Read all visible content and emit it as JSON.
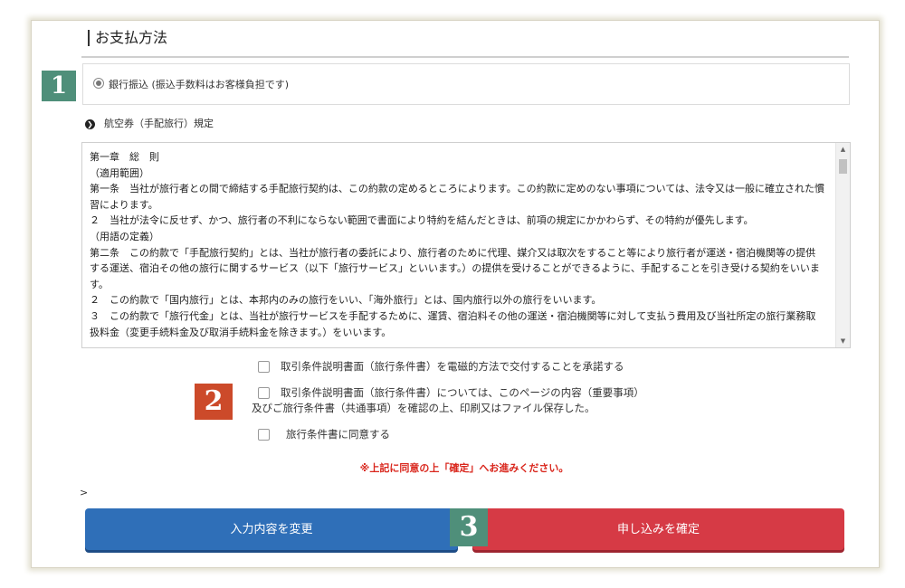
{
  "section": {
    "title": "お支払方法"
  },
  "badges": [
    "1",
    "2",
    "3"
  ],
  "payment": {
    "option_label": "銀行振込 (振込手数料はお客様負担です)",
    "selected": true
  },
  "rules_heading": {
    "icon": "circle-arrow-right-icon",
    "label": "航空券（手配旅行）規定"
  },
  "terms": {
    "lines": [
      "第一章　総　則",
      "（適用範囲）",
      "第一条　当社が旅行者との間で締結する手配旅行契約は、この約款の定めるところによります。この約款に定めのない事項については、法令又は一般に確立された慣習によります。",
      "２　当社が法令に反せず、かつ、旅行者の不利にならない範囲で書面により特約を結んだときは、前項の規定にかかわらず、その特約が優先します。",
      "（用語の定義）",
      "第二条　この約款で「手配旅行契約」とは、当社が旅行者の委託により、旅行者のために代理、媒介又は取次をすること等により旅行者が運送・宿泊機関等の提供する運送、宿泊その他の旅行に関するサービス（以下「旅行サービス」といいます。）の提供を受けることができるように、手配することを引き受ける契約をいいます。",
      "２　この約款で「国内旅行」とは、本邦内のみの旅行をいい、「海外旅行」とは、国内旅行以外の旅行をいいます。",
      "３　この約款で「旅行代金」とは、当社が旅行サービスを手配するために、運賃、宿泊料その他の運送・宿泊機関等に対して支払う費用及び当社所定の旅行業務取扱料金（変更手続料金及び取消手続料金を除きます。）をいいます。"
    ]
  },
  "checks": {
    "electronic": "取引条件説明書面（旅行条件書）を電磁的方法で交付することを承諾する",
    "confirm_line1": "取引条件説明書面（旅行条件書）については、このページの内容（重要事項）",
    "confirm_line2": "及びご旅行条件書（共通事項）を確認の上、印刷又はファイル保存した。",
    "agree": "旅行条件書に同意する"
  },
  "notice": "※上記に同意の上「確定」へお進みください。",
  "stray_text": ">",
  "buttons": {
    "change": "入力内容を変更",
    "confirm": "申し込みを確定"
  },
  "colors": {
    "change_button": "#2f6fb8",
    "confirm_button": "#d63a45",
    "notice": "#d9261c",
    "badge_green": "#4f8f7a",
    "badge_red": "#cc4a2a"
  }
}
